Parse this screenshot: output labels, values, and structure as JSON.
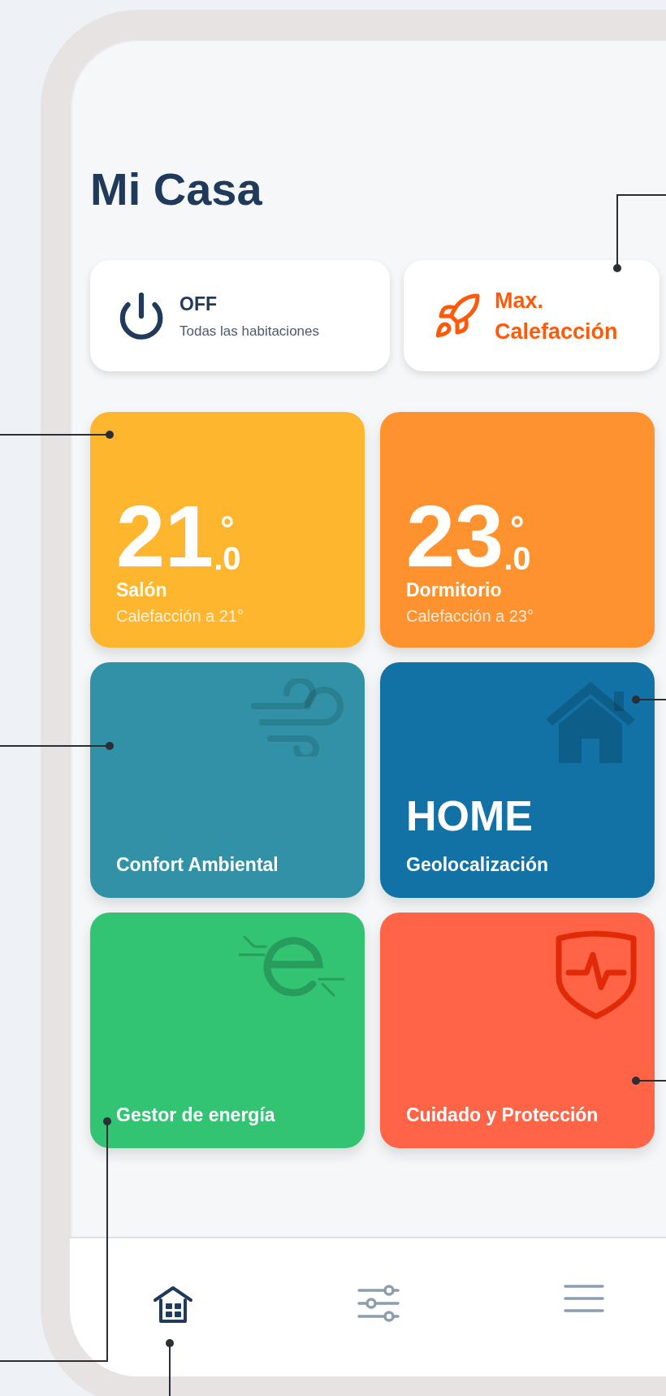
{
  "title": "Mi Casa",
  "quick_actions": [
    {
      "kind": "power",
      "title": "OFF",
      "subtitle": "Todas las habitaciones"
    },
    {
      "kind": "boost",
      "title": "Max. Calefacción"
    }
  ],
  "tile_rows": [
    {
      "tiles": [
        {
          "kind": "room",
          "value": "21",
          "unit": "°",
          "decimal": ".0",
          "name": "Salón",
          "status": "Calefacción a 21°",
          "color": "#fdb62e"
        },
        {
          "kind": "room",
          "value": "23",
          "unit": "°",
          "decimal": ".0",
          "name": "Dormitorio",
          "status": "Calefacción a 23°",
          "color": "#fe922f"
        }
      ]
    },
    {
      "tiles": [
        {
          "kind": "feature",
          "label": "Confort Ambiental",
          "color": "#3192a7"
        },
        {
          "kind": "status",
          "value": "HOME",
          "label": "Geolocalización",
          "color": "#1272a6"
        }
      ]
    },
    {
      "tiles": [
        {
          "kind": "feature",
          "label": "Gestor de energía",
          "color": "#33c473"
        },
        {
          "kind": "feature",
          "label": "Cuidado y Protección",
          "color": "#ff6447"
        }
      ]
    }
  ],
  "nav": [
    {
      "selected": true
    },
    {
      "selected": false
    },
    {
      "selected": false
    }
  ]
}
